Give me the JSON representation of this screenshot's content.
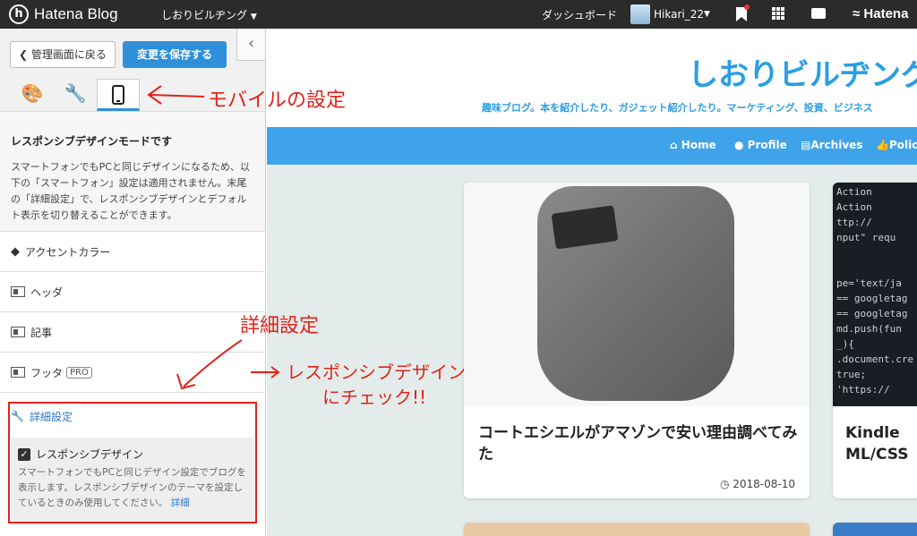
{
  "topbar": {
    "logo_text": "Hatena Blog",
    "logo_mark": "h",
    "blog_selector": "しおりビルヂング",
    "dashboard": "ダッシュボード",
    "username": "Hikari_22",
    "hatena_text": "Hatena"
  },
  "panel": {
    "back_button": "管理画面に戻る",
    "save_button": "変更を保存する",
    "collapse_icon": "‹",
    "tabs": [
      "design",
      "custom",
      "mobile"
    ],
    "info_title": "レスポンシブデザインモードです",
    "info_body": "スマートフォンでもPCと同じデザインになるため、以下の「スマートフォン」設定は適用されません。末尾の「詳細設定」で、レスポンシブデザインとデフォルト表示を切り替えることができます。",
    "menu": [
      {
        "label": "アクセントカラー"
      },
      {
        "label": "ヘッダ"
      },
      {
        "label": "記事"
      },
      {
        "label": "フッタ",
        "badge": "PRO"
      }
    ],
    "advanced_title": "詳細設定",
    "responsive_label": "レスポンシブデザイン",
    "responsive_checked": true,
    "responsive_desc": "スマートフォンでもPCと同じデザイン設定でブログを表示します。レスポンシブデザインのテーマを設定しているときのみ使用してください。",
    "detail_link": "詳細"
  },
  "preview": {
    "blog_title": "しおりビルヂング",
    "blog_desc": "趣味ブログ。本を紹介したり、ガジェット紹介したり。マーケティング、投資、ビジネス",
    "nav": [
      "Home",
      "Profile",
      "Archives",
      "Policy"
    ],
    "card1_title": "コートエシエルがアマゾンで安い理由調べてみた",
    "card1_date": "2018-08-10",
    "card2_title": "Kindle ML/CSS",
    "code_lines": [
      "Action",
      "Action",
      "ttp://",
      "nput\" requ",
      "",
      "",
      "pe='text/ja",
      "== googletag",
      "== googletag",
      "md.push(fun",
      "_){",
      ".document.cre",
      "true;",
      "'https://"
    ]
  },
  "annotations": {
    "mobile": "モバイルの設定",
    "detail": "詳細設定",
    "responsive": "レスポンシブデザイン",
    "check": "にチェック!!"
  },
  "colors": {
    "accent": "#2f90d9",
    "annotation_red": "#e0231c",
    "nav_blue": "#3fa3ea"
  }
}
